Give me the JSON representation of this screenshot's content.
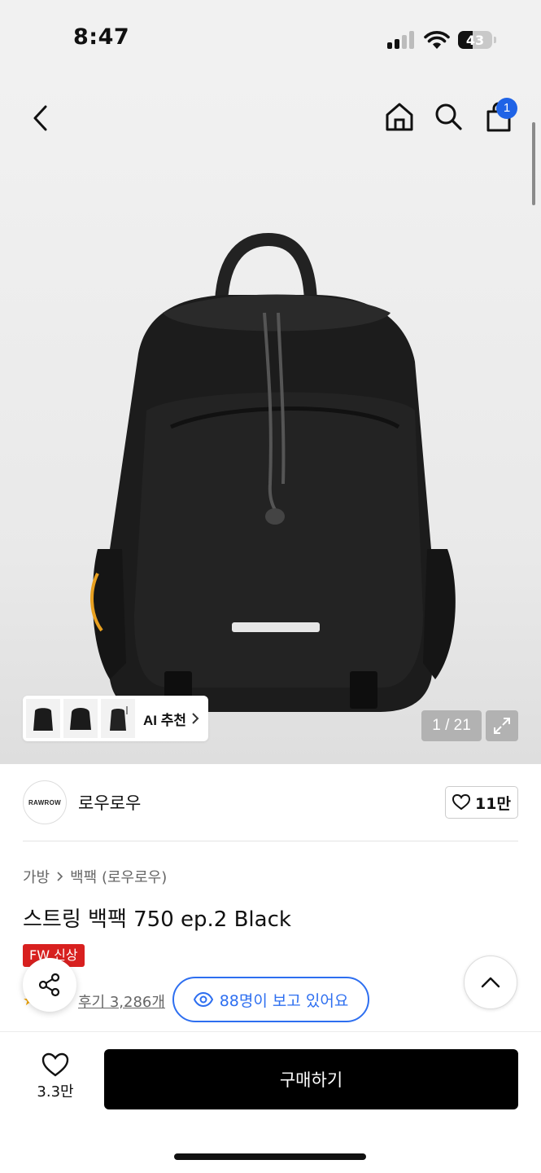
{
  "status_bar": {
    "time": "8:47",
    "battery": "43",
    "battery_level": 0.43
  },
  "header": {
    "icons": [
      "back-icon",
      "home-icon",
      "search-icon",
      "cart-icon"
    ],
    "cart_count": "1"
  },
  "gallery": {
    "ai_label": "AI 추천",
    "counter": "1 / 21"
  },
  "brand": {
    "logo_text": "RAWROW",
    "name": "로우로우",
    "likes": "11만"
  },
  "breadcrumb": {
    "category": "가방",
    "subcategory": "백팩 (로우로우)"
  },
  "product": {
    "title": "스트링 백팩 750 ep.2 Black",
    "badge": "FW 신상",
    "rating": "5",
    "reviews": "후기 3,286개",
    "watching": "88명이 보고 있어요"
  },
  "bottom": {
    "wish_count": "3.3만",
    "buy_label": "구매하기"
  },
  "colors": {
    "accent_blue": "#2e6ff0",
    "badge_red": "#d8201f",
    "buy_black": "#000000"
  }
}
